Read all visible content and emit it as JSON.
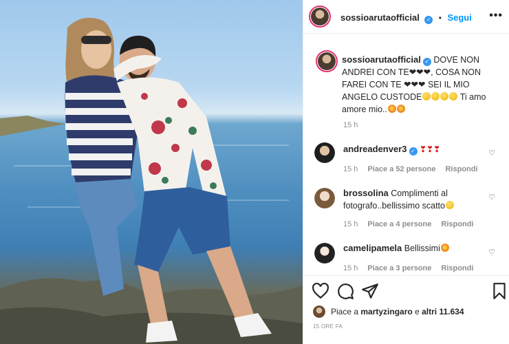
{
  "post": {
    "username": "sossioarutaofficial",
    "follow_label": "Segui",
    "more_label": "•••",
    "caption": "DOVE NON ANDREI CON TE❤❤❤, COSA NON FAREI CON TE ❤❤❤ SEI IL MIO ANGELO CUSTODE",
    "caption_tail": "Ti amo amore mio..",
    "time": "15 h"
  },
  "comments": [
    {
      "username": "andreadenver3",
      "text": "",
      "time": "15 h",
      "likes": "Piace a 52 persone",
      "reply": "Rispondi"
    },
    {
      "username": "brossolina",
      "text": "Complimenti al fotografo..bellissimo scatto",
      "time": "15 h",
      "likes": "Piace a 4 persone",
      "reply": "Rispondi"
    },
    {
      "username": "camelipamela",
      "text": "Bellissimi",
      "time": "15 h",
      "likes": "Piace a 3 persone",
      "reply": "Rispondi"
    }
  ],
  "likes_summary": {
    "prefix": "Piace a",
    "user": "martyzingaro",
    "mid": "e",
    "others": "altri 11.634"
  },
  "date_label": "15 ORE FA",
  "colors": {
    "accent": "#0095f6",
    "verified": "#3897f0",
    "heart": "#d62020"
  },
  "icons": [
    "heart-icon",
    "comment-icon",
    "share-icon",
    "bookmark-icon",
    "verified-icon",
    "more-options-icon"
  ]
}
